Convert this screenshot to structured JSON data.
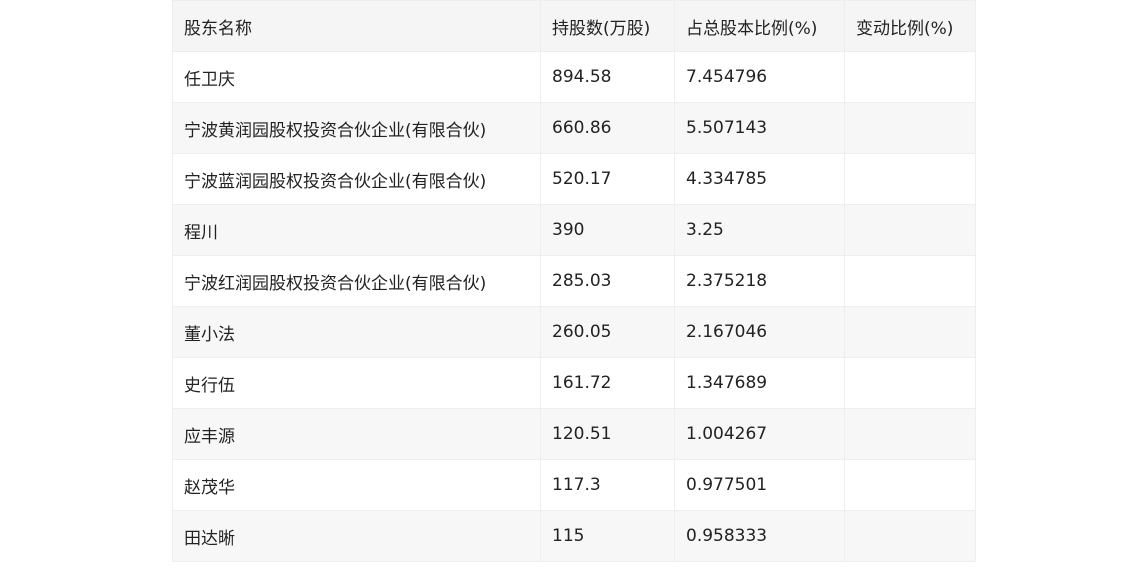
{
  "table": {
    "headers": [
      "股东名称",
      "持股数(万股)",
      "占总股本比例(%)",
      "变动比例(%)"
    ],
    "rows": [
      [
        "任卫庆",
        "894.58",
        "7.454796",
        ""
      ],
      [
        "宁波黄润园股权投资合伙企业(有限合伙)",
        "660.86",
        "5.507143",
        ""
      ],
      [
        "宁波蓝润园股权投资合伙企业(有限合伙)",
        "520.17",
        "4.334785",
        ""
      ],
      [
        "程川",
        "390",
        "3.25",
        ""
      ],
      [
        "宁波红润园股权投资合伙企业(有限合伙)",
        "285.03",
        "2.375218",
        ""
      ],
      [
        "董小法",
        "260.05",
        "2.167046",
        ""
      ],
      [
        "史行伍",
        "161.72",
        "1.347689",
        ""
      ],
      [
        "应丰源",
        "120.51",
        "1.004267",
        ""
      ],
      [
        "赵茂华",
        "117.3",
        "0.977501",
        ""
      ],
      [
        "田达晰",
        "115",
        "0.958333",
        ""
      ]
    ]
  }
}
